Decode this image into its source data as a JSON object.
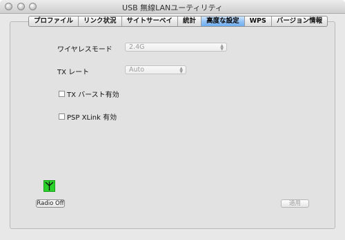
{
  "window": {
    "title": "USB 無線LANユーティリティ"
  },
  "tabs": [
    {
      "label": "プロファイル",
      "active": false
    },
    {
      "label": "リンク状況",
      "active": false
    },
    {
      "label": "サイトサーベイ",
      "active": false
    },
    {
      "label": "統計",
      "active": false
    },
    {
      "label": "高度な設定",
      "active": true
    },
    {
      "label": "WPS",
      "active": false
    },
    {
      "label": "バージョン情報",
      "active": false
    }
  ],
  "settings": {
    "wireless_mode_label": "ワイヤレスモード",
    "wireless_mode_value": "2.4G",
    "tx_rate_label": "TX レート",
    "tx_rate_value": "Auto",
    "tx_burst_label": "TX バースト有効",
    "tx_burst_checked": false,
    "psp_xlink_label": "PSP XLink 有効",
    "psp_xlink_checked": false
  },
  "buttons": {
    "radio_off": "Radio Off",
    "apply": "適用"
  },
  "colors": {
    "active_tab": "#8fc0f4",
    "antenna_indicator": "#2bd22b"
  }
}
